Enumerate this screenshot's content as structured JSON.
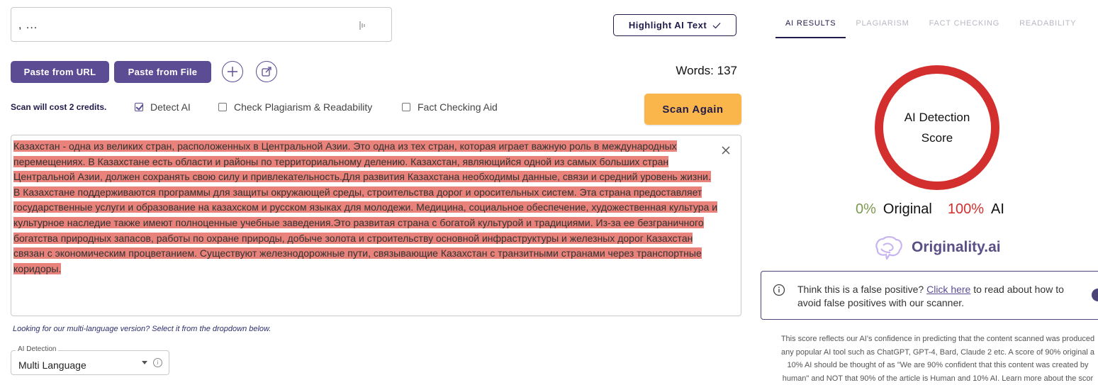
{
  "title_input": {
    "value": ",      ..."
  },
  "toolbar": {
    "highlight_label": "Highlight AI Text",
    "paste_url_label": "Paste from URL",
    "paste_file_label": "Paste from File",
    "words_label": "Words: 137",
    "scan_label": "Scan Again"
  },
  "options": {
    "cost_text": "Scan will cost 2 credits.",
    "detect_ai": {
      "label": "Detect AI",
      "checked": true
    },
    "plagiarism": {
      "label": "Check Plagiarism & Readability",
      "checked": false
    },
    "fact_check": {
      "label": "Fact Checking Aid",
      "checked": false
    }
  },
  "editor": {
    "text": "Казахстан - одна из великих стран, расположенных в Центральной Азии. Это одна из тех стран, которая играет важную роль в международных перемещениях. В Казахстане есть области и районы по территориальному делению. Казахстан, являющийся одной из самых больших стран Центральной Азии, должен сохранять свою силу и привлекательность.Для развития Казахстана необходимы данные, связи и средний уровень жизни. В Казахстане поддерживаются программы для защиты окружающей среды, строительства дорог и оросительных систем. Эта страна предоставляет государственные услуги и образование на казахском и русском языках для молодежи. Медицина, социальное обеспечение, художественная культура и культурное наследие также имеют полноценные учебные заведения.Это развитая страна с богатой культурой и традициями. Из-за ее безграничного богатства природных запасов, работы по охране природы, добыче золота и строительству основной инфраструктуры и железных дорог Казахстан связан с экономическим процветанием. Существуют железнодорожные пути, связывающие Казахстан с транзитными странами через транспортные коридоры."
  },
  "multi_note": "Looking for our multi-language version? Select it from the dropdown below.",
  "language_select": {
    "label": "AI Detection",
    "value": "Multi Language"
  },
  "tabs": [
    {
      "label": "AI RESULTS",
      "active": true
    },
    {
      "label": "PLAGIARISM",
      "active": false
    },
    {
      "label": "FACT CHECKING",
      "active": false
    },
    {
      "label": "READABILITY",
      "active": false
    }
  ],
  "results": {
    "ring_title": "AI Detection Score",
    "original_pct": "0%",
    "original_label": "Original",
    "ai_pct": "100%",
    "ai_label": "AI",
    "brand": "Originality.ai",
    "ring_color": "#d32f2f"
  },
  "false_positive": {
    "prefix": "Think this is a false positive?",
    "link": "Click here",
    "suffix": " to read about how to avoid false positives with our scanner."
  },
  "disclaimer": {
    "line1": "This score reflects our AI's confidence in predicting that the content scanned was produced",
    "line2": "any popular AI tool such as ChatGPT, GPT-4, Bard, Claude 2 etc. A score of 90% original a",
    "line3": "10% AI should be thought of as \"We are 90% confident that this content was created by",
    "line4": "human\" and NOT that 90% of the article is Human and 10% AI. Learn more about the scor"
  },
  "colors": {
    "accent": "#5b4c94",
    "scan": "#fbb64b",
    "highlight": "#e8827a",
    "dark": "#1f1b4a"
  }
}
